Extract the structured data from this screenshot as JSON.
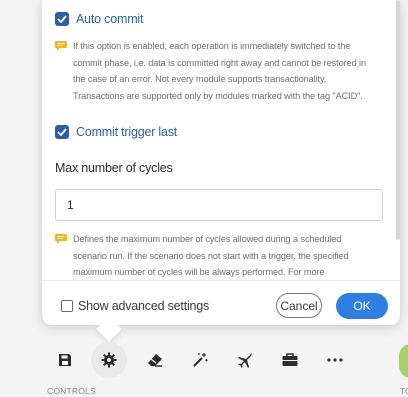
{
  "settings": {
    "auto_commit": {
      "label": "Auto commit",
      "checked": true,
      "note_lines": [
        "If this option is enabled, each operation is immediately switched to the",
        "commit phase, i.e. data is committed right away and cannot be restored in",
        "the case of an error. Not every module supports transactionality.",
        "Transactions are supported only by modules marked with the tag \"ACID\"."
      ]
    },
    "commit_trigger_last": {
      "label": "Commit trigger last",
      "checked": true
    },
    "max_cycles": {
      "label": "Max number of cycles",
      "value": "1",
      "note_lines": [
        "Defines the maximum number of cycles allowed during a scheduled",
        "scenario run. If the scenario does not start with a trigger, the specified",
        "maximum number of cycles will be always performed. For more"
      ]
    }
  },
  "footer": {
    "show_advanced_label": "Show advanced settings",
    "show_advanced_checked": false,
    "cancel_label": "Cancel",
    "ok_label": "OK"
  },
  "toolbar": {
    "items": [
      {
        "icon": "save-icon"
      },
      {
        "icon": "gear-icon",
        "active": true
      },
      {
        "icon": "eraser-icon"
      },
      {
        "icon": "magic-wand-icon"
      },
      {
        "icon": "airplane-icon"
      },
      {
        "icon": "briefcase-icon"
      },
      {
        "icon": "more-icon"
      }
    ],
    "section_label": "CONTROLS",
    "next_section_label": "TO"
  },
  "colors": {
    "accent": "#2d5ea8",
    "ok_button": "#2f7fe0",
    "note_icon": "#f5b322"
  }
}
